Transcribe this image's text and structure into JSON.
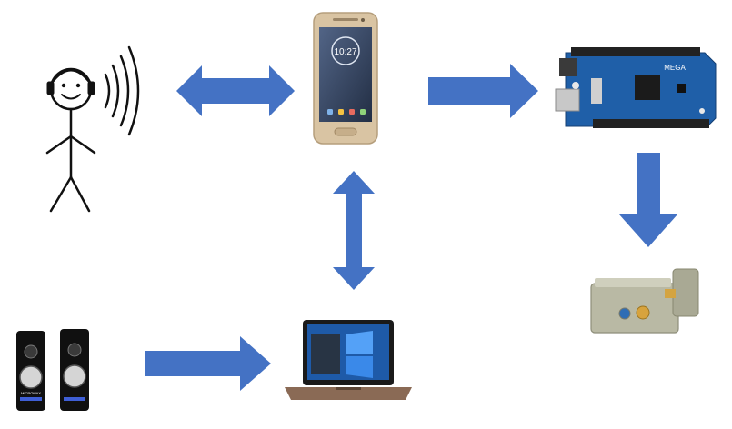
{
  "diagram": {
    "nodes": [
      {
        "id": "person",
        "icon": "stick-figure-headphones-icon"
      },
      {
        "id": "smartphone",
        "icon": "smartphone-icon",
        "screen_time": "10:27"
      },
      {
        "id": "microcontroller",
        "icon": "arduino-mega-board-icon",
        "board_label": "MEGA"
      },
      {
        "id": "door-lock",
        "icon": "electric-door-lock-icon"
      },
      {
        "id": "speakers",
        "icon": "speakers-icon",
        "brand_label": "MICROMAX"
      },
      {
        "id": "laptop",
        "icon": "laptop-icon"
      }
    ],
    "edges": [
      {
        "from": "person",
        "to": "smartphone",
        "direction": "both"
      },
      {
        "from": "smartphone",
        "to": "microcontroller",
        "direction": "forward"
      },
      {
        "from": "microcontroller",
        "to": "door-lock",
        "direction": "forward"
      },
      {
        "from": "smartphone",
        "to": "laptop",
        "direction": "both"
      },
      {
        "from": "speakers",
        "to": "laptop",
        "direction": "forward"
      }
    ],
    "colors": {
      "arrow": "#4472C4",
      "board": "#1f5fa8",
      "phone_body": "#d9c4a3",
      "lock_body": "#b9b9a4"
    }
  }
}
